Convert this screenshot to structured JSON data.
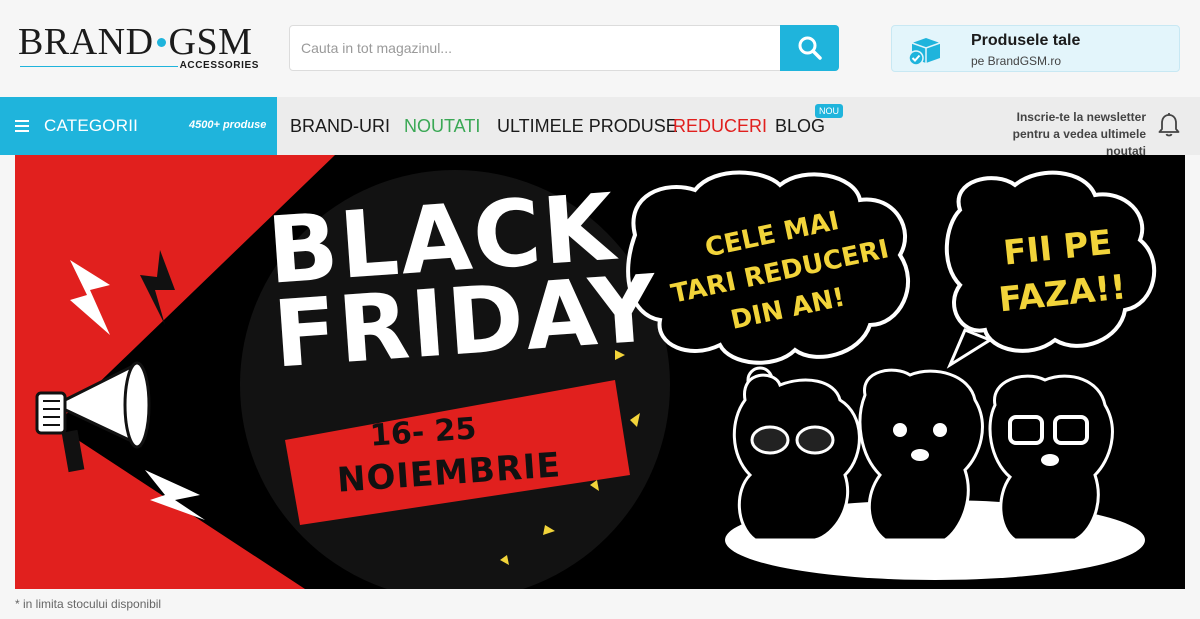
{
  "header": {
    "logo_main": "BRAND",
    "logo_main2": "GSM",
    "logo_sub": "ACCESSORIES",
    "search": {
      "placeholder": "Cauta in tot magazinul..."
    },
    "products": {
      "title": "Produsele tale",
      "subtitle": "pe BrandGSM.ro"
    }
  },
  "nav": {
    "categories_label": "CATEGORII",
    "categories_count": "4500+ produse",
    "items": [
      {
        "label": "BRAND-URI"
      },
      {
        "label": "NOUTATI"
      },
      {
        "label": "ULTIMELE PRODUSE"
      },
      {
        "label": "REDUCERI"
      },
      {
        "label": "BLOG"
      }
    ],
    "new_badge": "NOU",
    "newsletter_line1": "Inscrie-te la newsletter",
    "newsletter_line2": "pentru a vedea ultimele noutati"
  },
  "banner": {
    "title_line1": "BLACK",
    "title_line2": "FRIDAY",
    "dates": "16- 25",
    "month": "NOIEMBRIE",
    "bubble1_line1": "CELE MAI",
    "bubble1_line2": "TARI REDUCERI",
    "bubble1_line3": "DIN AN!",
    "bubble2_line1": "FII PE",
    "bubble2_line2": "FAZA!!"
  },
  "footnote": "* in limita stocului disponibil",
  "colors": {
    "accent": "#1fb4dc",
    "green": "#3aa855",
    "red": "#e1201e",
    "banner_yellow": "#f2d43a"
  }
}
